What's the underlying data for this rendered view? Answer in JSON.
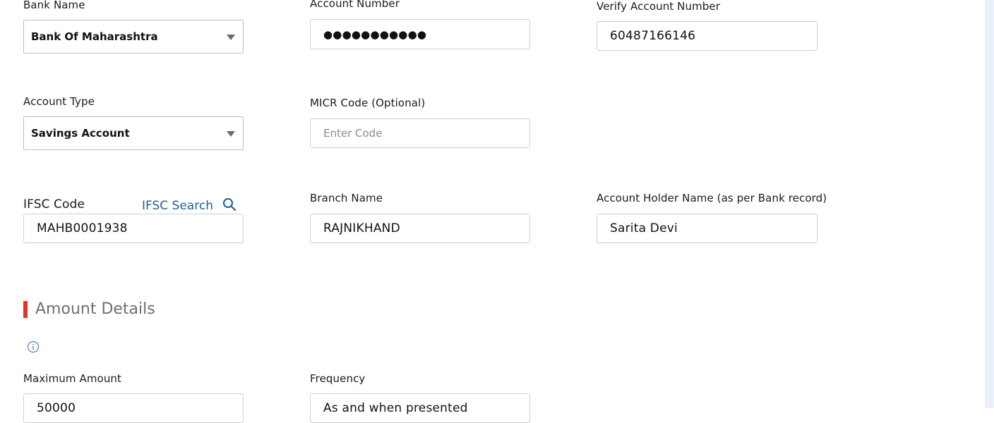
{
  "bank_details": {
    "bank_name": {
      "label": "Bank Name",
      "value": "Bank Of Maharashtra"
    },
    "account_number": {
      "label": "Account Number",
      "value": "●●●●●●●●●●●"
    },
    "verify_account_number": {
      "label": "Verify Account Number",
      "value": "60487166146"
    },
    "account_type": {
      "label": "Account Type",
      "value": "Savings Account"
    },
    "micr_code": {
      "label": "MICR Code (Optional)",
      "placeholder": "Enter Code"
    },
    "ifsc_code": {
      "label": "IFSC Code",
      "value": "MAHB0001938"
    },
    "ifsc_search": {
      "label": "IFSC Search",
      "icon": "search-icon"
    },
    "branch_name": {
      "label": "Branch Name",
      "value": "RAJNIKHAND"
    },
    "account_holder_name": {
      "label": "Account Holder Name (as per Bank record)",
      "value": "Sarita Devi"
    }
  },
  "amount_details": {
    "title": "Amount Details",
    "info_icon": "info-icon",
    "accent_color": "#e03427",
    "maximum_amount": {
      "label": "Maximum Amount",
      "value": "50000"
    },
    "frequency": {
      "label": "Frequency",
      "value": "As and when presented"
    }
  }
}
